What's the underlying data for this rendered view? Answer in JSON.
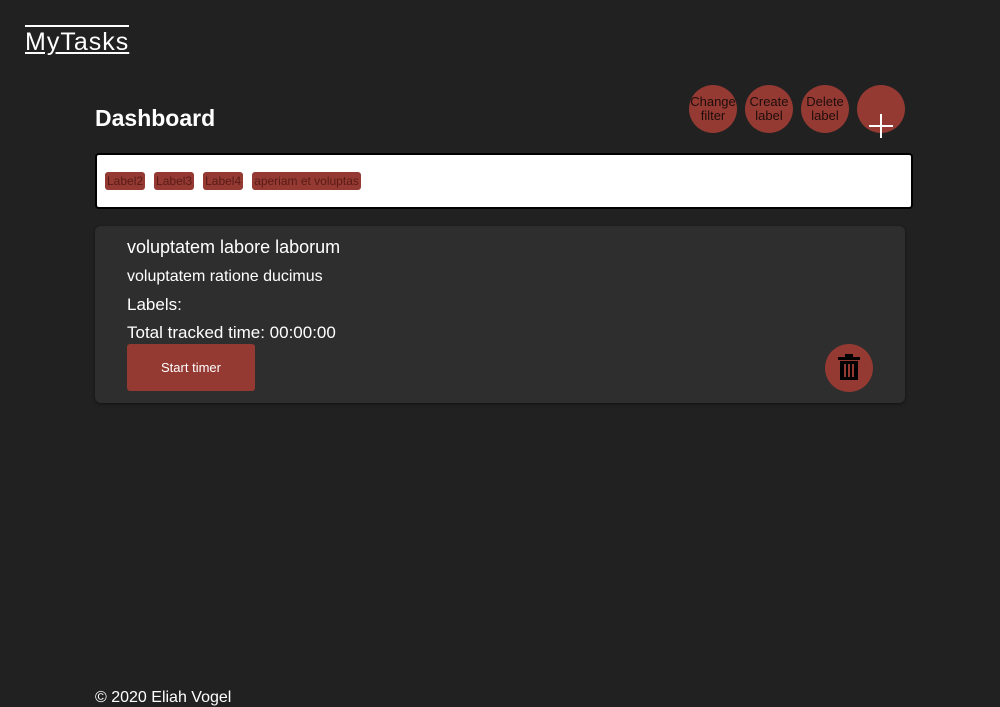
{
  "app": {
    "logo": "MyTasks"
  },
  "dashboard": {
    "title": "Dashboard",
    "toolbar": {
      "change_filter": "Change\nfilter",
      "create_label": "Create\nlabel",
      "delete_label": "Delete\nlabel",
      "add_icon": "plus-icon"
    }
  },
  "filter": {
    "labels": [
      "Label2",
      "Label3",
      "Label4",
      "aperiam et voluptas"
    ]
  },
  "task": {
    "title": "voluptatem labore laborum",
    "description": "voluptatem ratione ducimus",
    "labels_heading": "Labels:",
    "tracked_time": "Total tracked time: 00:00:00",
    "start_button": "Start timer",
    "delete_icon": "trash-icon"
  },
  "footer": {
    "copyright": "© 2020 Eliah Vogel"
  },
  "colors": {
    "background": "#212121",
    "card": "#2e2e2e",
    "accent": "#943a33"
  }
}
